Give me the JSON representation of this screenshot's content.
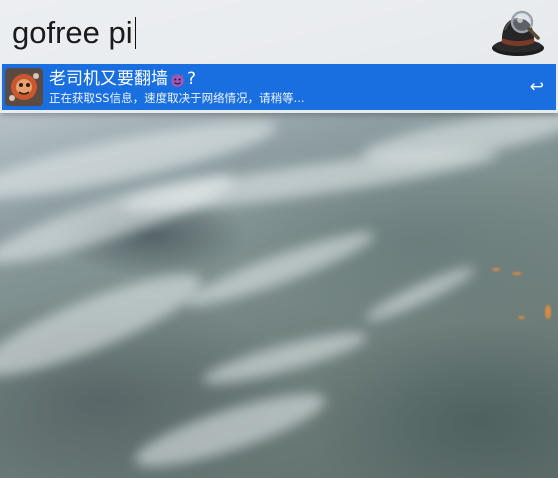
{
  "search": {
    "value": "gofree pi"
  },
  "result": {
    "title_prefix": "老司机又要翻墙",
    "title_suffix": "?",
    "subtitle": "正在获取SS信息，速度取决于网络情况，请稍等...",
    "return_hint": "↩"
  },
  "icons": {
    "app": "alfred-hat-icon",
    "result": "workflow-icon",
    "emoji": "smiling-devil-emoji",
    "return": "return-key-icon"
  },
  "colors": {
    "selection": "#1a6fe0",
    "window": "#eef0f2"
  }
}
